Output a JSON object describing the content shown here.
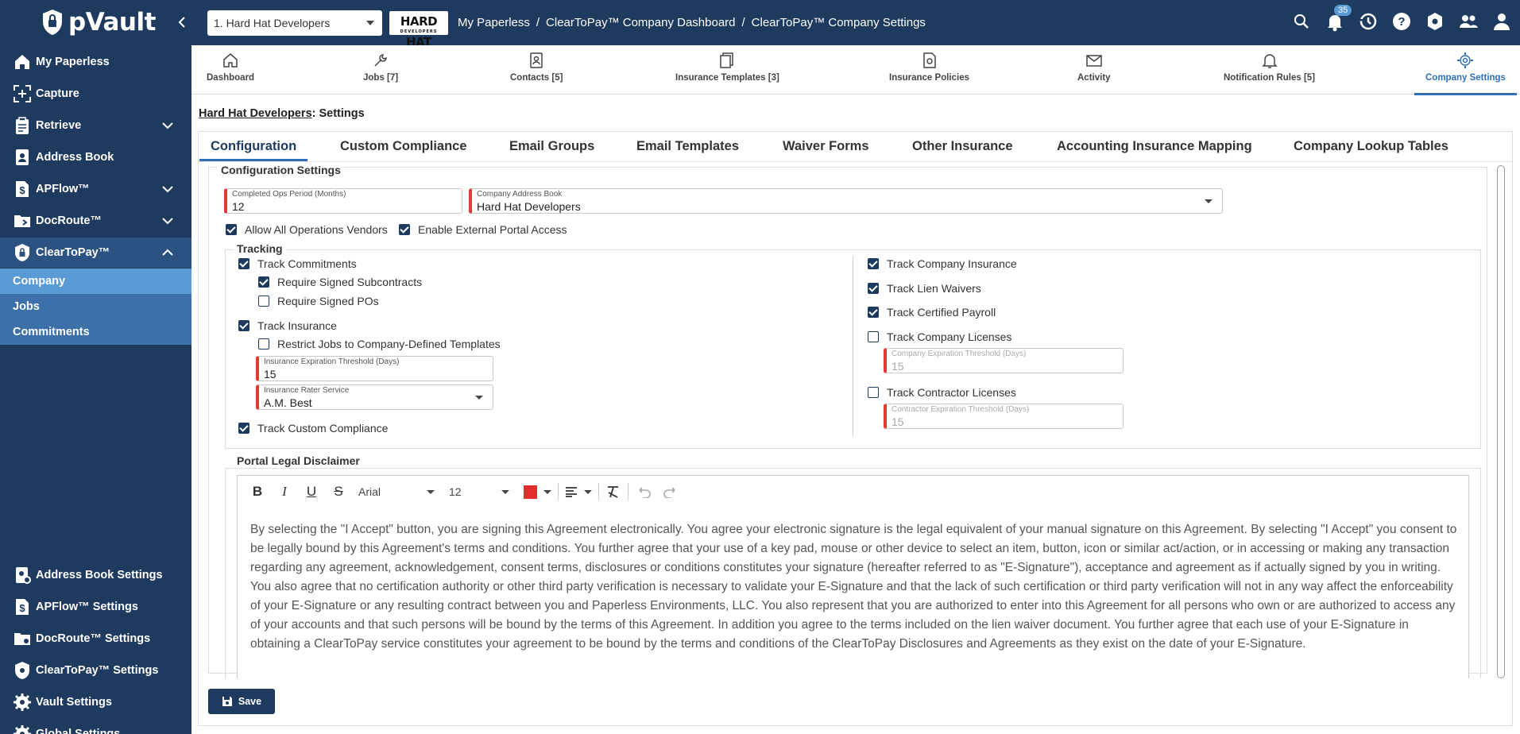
{
  "app": {
    "logo_text": "pVault",
    "company_select": "1. Hard Hat Developers",
    "company_logo_text": "HARD HAT",
    "company_logo_sub": "DEVELOPERS",
    "breadcrumb": [
      "My Paperless",
      "ClearToPay™ Company Dashboard",
      "ClearToPay™ Company Settings"
    ],
    "breadcrumb_sep": "/",
    "notification_count": "35"
  },
  "sidebar": {
    "top_items": [
      {
        "label": "My Paperless",
        "icon": "home-icon"
      },
      {
        "label": "Capture",
        "icon": "capture-icon"
      },
      {
        "label": "Retrieve",
        "icon": "clipboard-icon"
      },
      {
        "label": "Address Book",
        "icon": "address-book-icon"
      },
      {
        "label": "APFlow™",
        "icon": "dollar-icon"
      },
      {
        "label": "DocRoute™",
        "icon": "folder-icon"
      },
      {
        "label": "ClearToPay™",
        "icon": "shield-icon"
      }
    ],
    "sub_items": [
      "Company",
      "Jobs",
      "Commitments"
    ],
    "bottom_items": [
      {
        "label": "Address Book Settings"
      },
      {
        "label": "APFlow™ Settings"
      },
      {
        "label": "DocRoute™ Settings"
      },
      {
        "label": "ClearToPay™ Settings"
      },
      {
        "label": "Vault Settings"
      },
      {
        "label": "Global Settings"
      }
    ]
  },
  "module_tabs": [
    {
      "label": "Dashboard",
      "icon": "home-icon"
    },
    {
      "label": "Jobs [7]",
      "icon": "wrench-icon"
    },
    {
      "label": "Contacts [5]",
      "icon": "contacts-icon"
    },
    {
      "label": "Insurance Templates [3]",
      "icon": "templates-icon"
    },
    {
      "label": "Insurance Policies",
      "icon": "policy-icon"
    },
    {
      "label": "Activity",
      "icon": "envelope-icon"
    },
    {
      "label": "Notification Rules [5]",
      "icon": "bell-icon"
    },
    {
      "label": "Company Settings",
      "icon": "gear-icon"
    }
  ],
  "heading": {
    "company": "Hard Hat Developers",
    "rest": ": Settings"
  },
  "settings_tabs": [
    "Configuration",
    "Custom Compliance",
    "Email Groups",
    "Email Templates",
    "Waiver Forms",
    "Other Insurance",
    "Accounting Insurance Mapping",
    "Company Lookup Tables"
  ],
  "config": {
    "legend": "Configuration Settings",
    "completed_ops_label": "Completed Ops Period (Months)",
    "completed_ops_value": "12",
    "address_book_label": "Company Address Book",
    "address_book_value": "Hard Hat Developers",
    "allow_all_ops": "Allow All Operations Vendors",
    "enable_portal": "Enable External Portal Access",
    "tracking_legend": "Tracking",
    "track_commitments": "Track Commitments",
    "require_signed_subcontracts": "Require Signed Subcontracts",
    "require_signed_pos": "Require Signed POs",
    "track_insurance": "Track Insurance",
    "restrict_jobs": "Restrict Jobs to Company-Defined Templates",
    "ins_exp_label": "Insurance Expiration Threshold (Days)",
    "ins_exp_value": "15",
    "rater_label": "Insurance Rater Service",
    "rater_value": "A.M. Best",
    "track_custom": "Track Custom Compliance",
    "track_company_insurance": "Track Company Insurance",
    "track_lien_waivers": "Track Lien Waivers",
    "track_certified_payroll": "Track Certified Payroll",
    "track_company_licenses": "Track Company Licenses",
    "company_exp_label": "Company Expiration Threshold (Days)",
    "company_exp_value": "15",
    "track_contractor_licenses": "Track Contractor Licenses",
    "contractor_exp_label": "Contractor Expiration Threshold (Days)",
    "contractor_exp_value": "15",
    "disclaimer_legend": "Portal Legal Disclaimer"
  },
  "editor": {
    "bold": "B",
    "italic": "I",
    "underline": "U",
    "strike": "S",
    "font": "Arial",
    "size": "12",
    "text_color": "#e52d2d",
    "text": "By selecting the \"I Accept\" button, you are signing this Agreement electronically. You agree your electronic signature is the legal equivalent of your manual signature on this Agreement. By selecting \"I Accept\" you consent to be legally bound by this Agreement's terms and conditions. You further agree that your use of a key pad, mouse or other device to select an item, button, icon or similar act/action, or in accessing or making any transaction regarding any agreement, acknowledgement, consent terms, disclosures or conditions constitutes your signature (hereafter referred to as \"E-Signature\"), acceptance and agreement as if actually signed by you in writing. You also agree that no certification authority or other third party verification is necessary to validate your E-Signature and that the lack of such certification or third party verification will not in any way affect the enforceability of your E-Signature or any resulting contract between you and Paperless Environments, LLC. You also represent that you are authorized to enter into this Agreement for all persons who own or are authorized to access any of your accounts and that such persons will be bound by the terms of this Agreement. In addition you agree to the terms included on the lien waiver document. You further agree that each use of your E-Signature in obtaining a ClearToPay service constitutes your agreement to be bound by the terms and conditions of the ClearToPay Disclosures and Agreements as they exist on the date of your E-Signature."
  },
  "save_label": "Save",
  "colors": {
    "nav": "#1e3a5f",
    "accent": "#2f6fb5",
    "required": "#e53935"
  }
}
